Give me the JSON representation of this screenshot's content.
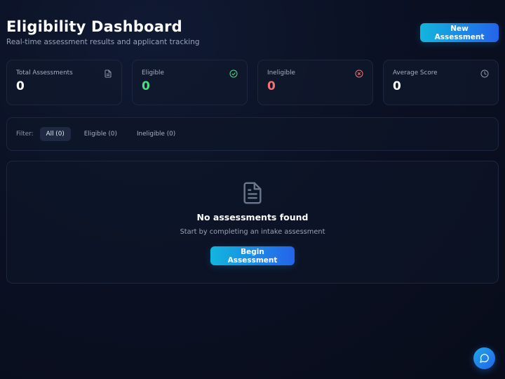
{
  "header": {
    "title": "Eligibility Dashboard",
    "subtitle": "Real-time assessment results and applicant tracking",
    "new_assessment_label": "New Assessment"
  },
  "stats": [
    {
      "label": "Total Assessments",
      "value": "0",
      "icon": "document-icon",
      "value_color": "#ffffff"
    },
    {
      "label": "Eligible",
      "value": "0",
      "icon": "check-circle-icon",
      "value_color": "#4ade80"
    },
    {
      "label": "Ineligible",
      "value": "0",
      "icon": "x-circle-icon",
      "value_color": "#f87171"
    },
    {
      "label": "Average Score",
      "value": "0",
      "icon": "clock-icon",
      "value_color": "#ffffff"
    }
  ],
  "filter": {
    "label": "Filter:",
    "options": [
      {
        "label": "All (0)",
        "active": true
      },
      {
        "label": "Eligible (0)",
        "active": false
      },
      {
        "label": "Ineligible (0)",
        "active": false
      }
    ]
  },
  "empty_state": {
    "icon": "document-icon",
    "title": "No assessments found",
    "subtitle": "Start by completing an intake assessment",
    "button_label": "Begin Assessment"
  },
  "chat": {
    "icon": "chat-bubble-icon"
  },
  "colors": {
    "accent_start": "#12b6dd",
    "accent_end": "#2563eb",
    "eligible": "#4ade80",
    "ineligible": "#f87171"
  }
}
